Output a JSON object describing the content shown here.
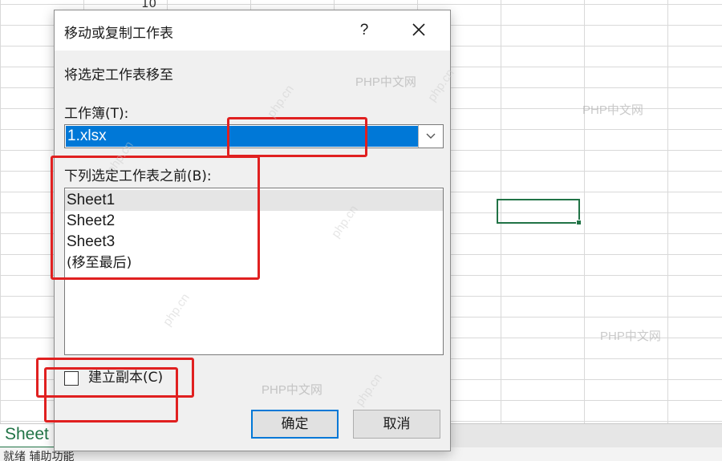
{
  "spreadsheet": {
    "visible_cell_value": "10",
    "sheet_tab_label": "Sheet",
    "status_text": "就绪    辅助功能",
    "colors": {
      "accent": "#217346"
    }
  },
  "dialog": {
    "title": "移动或复制工作表",
    "help_label": "?",
    "instruction": "将选定工作表移至",
    "workbook_label": "工作簿(T):",
    "workbook_selected": "1.xlsx",
    "before_label": "下列选定工作表之前(B):",
    "sheets": [
      "Sheet1",
      "Sheet2",
      "Sheet3",
      "(移至最后)"
    ],
    "selected_sheet_index": 0,
    "create_copy_label": "建立副本(C)",
    "create_copy_checked": false,
    "ok_label": "确定",
    "cancel_label": "取消",
    "colors": {
      "selection": "#0078d7",
      "annotation": "#e02020"
    }
  },
  "watermarks": {
    "text": "PHP中文网",
    "rotated_text": "php.cn"
  },
  "icons": {
    "close": "close-icon",
    "dropdown": "chevron-down-icon"
  }
}
